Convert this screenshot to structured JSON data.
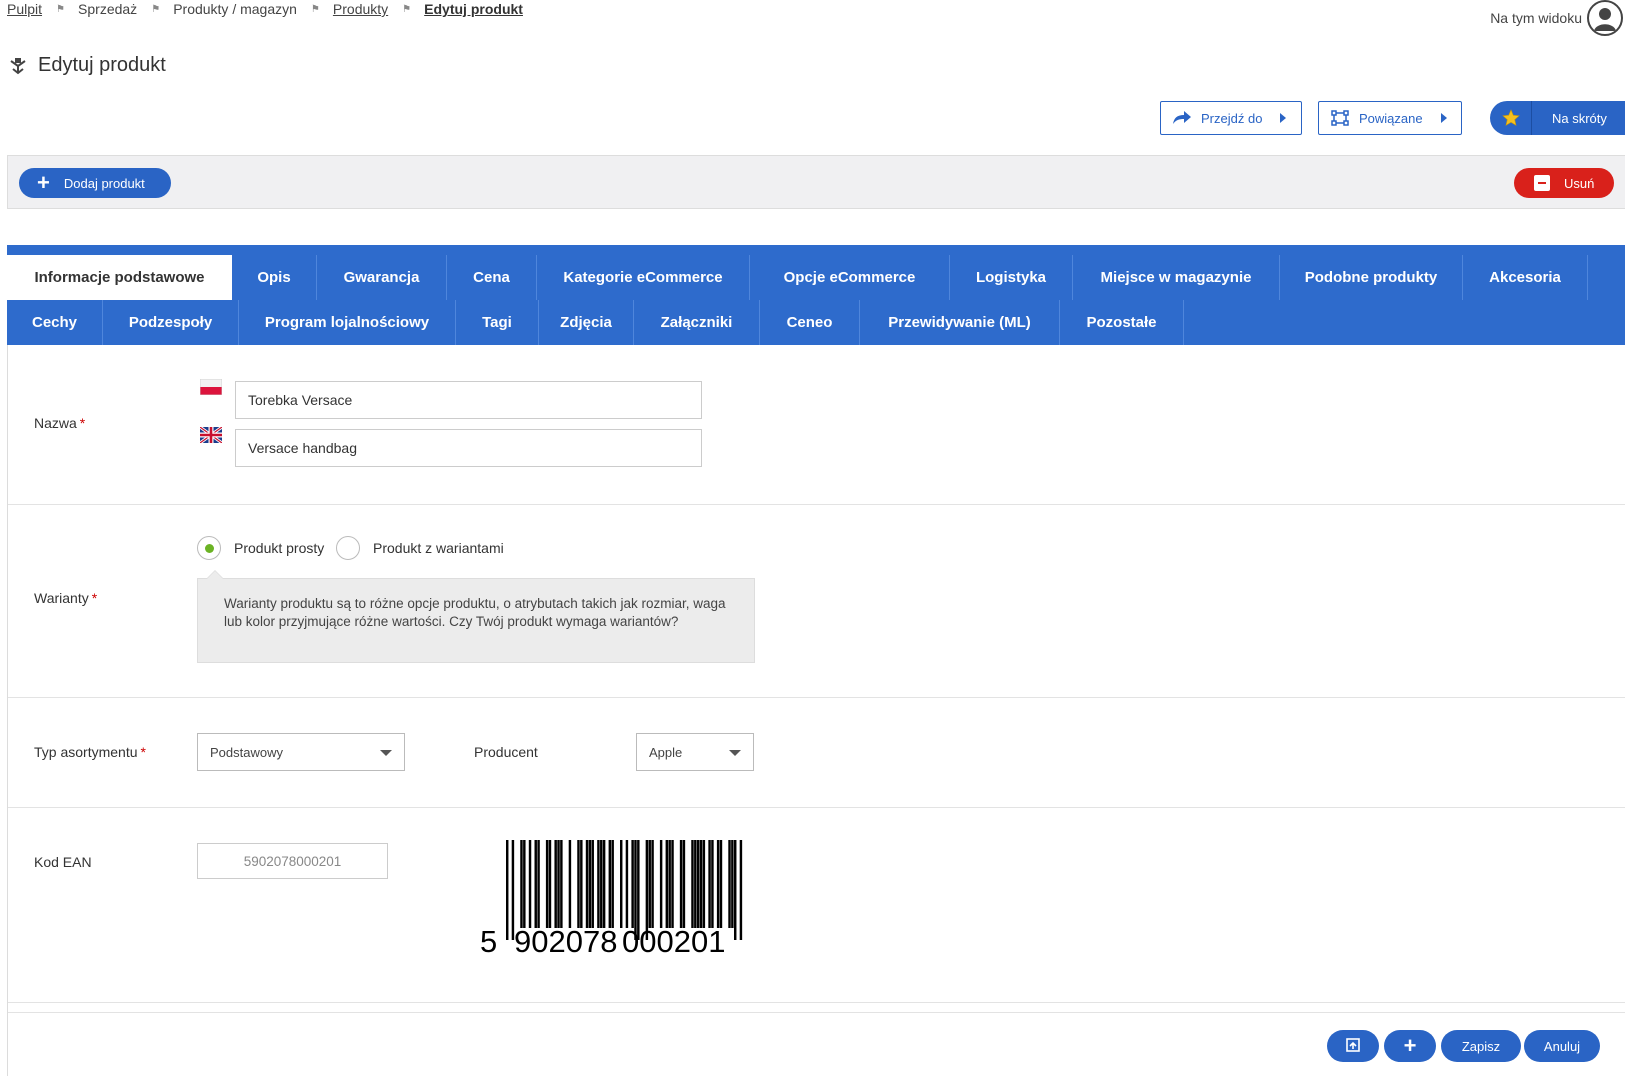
{
  "breadcrumb": {
    "items": [
      {
        "label": "Pulpit",
        "link": true
      },
      {
        "label": "Sprzedaż",
        "link": false
      },
      {
        "label": "Produkty / magazyn",
        "link": false
      },
      {
        "label": "Produkty",
        "link": true
      },
      {
        "label": "Edytuj produkt",
        "current": true
      }
    ]
  },
  "user": {
    "view_label": "Na tym widoku"
  },
  "page": {
    "title": "Edytuj produkt"
  },
  "toolbar": {
    "goto_label": "Przejdź do",
    "related_label": "Powiązane",
    "shortcuts_label": "Na skróty"
  },
  "actions": {
    "add_label": "Dodaj produkt",
    "delete_label": "Usuń"
  },
  "tabs": {
    "row1": [
      "Informacje podstawowe",
      "Opis",
      "Gwarancja",
      "Cena",
      "Kategorie eCommerce",
      "Opcje eCommerce",
      "Logistyka",
      "Miejsce w magazynie",
      "Podobne produkty",
      "Akcesoria"
    ],
    "row2": [
      "Cechy",
      "Podzespoły",
      "Program lojalnościowy",
      "Tagi",
      "Zdjęcia",
      "Załączniki",
      "Ceneo",
      "Przewidywanie (ML)",
      "Pozostałe"
    ],
    "active": "Informacje podstawowe"
  },
  "form": {
    "name": {
      "label": "Nazwa",
      "required_mark": "*",
      "value_pl": "Torebka Versace",
      "value_en": "Versace handbag"
    },
    "variants": {
      "label": "Warianty",
      "required_mark": "*",
      "option_simple": "Produkt prosty",
      "option_variants": "Produkt z wariantami",
      "selected": "Produkt prosty",
      "hint": "Warianty produktu są to różne opcje produktu, o atrybutach takich jak rozmiar, waga lub kolor przyjmujące różne wartości. Czy Twój produkt wymaga wariantów?"
    },
    "assortment": {
      "label": "Typ asortymentu",
      "required_mark": "*",
      "value": "Podstawowy"
    },
    "producer": {
      "label": "Producent",
      "value": "Apple"
    },
    "ean": {
      "label": "Kod EAN",
      "value": "5902078000201",
      "barcode_first": "5",
      "barcode_left": "902078",
      "barcode_right": "000201"
    }
  },
  "footer": {
    "save_label": "Zapisz",
    "cancel_label": "Anuluj"
  },
  "colors": {
    "primary": "#2a64c5",
    "tab_bar": "#2e6bcc",
    "danger": "#d9211b",
    "radio_on": "#6bb324"
  }
}
